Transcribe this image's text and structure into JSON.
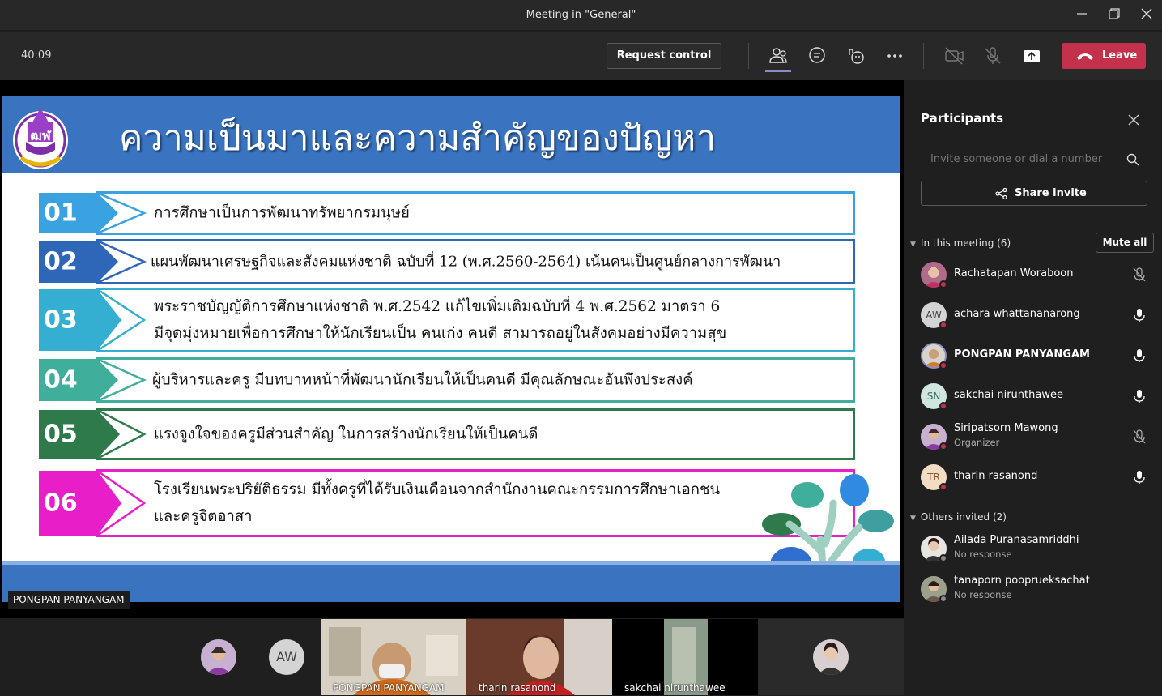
{
  "window": {
    "title": "Meeting in \"General\""
  },
  "toolbar": {
    "timer": "40:09",
    "request_control_label": "Request control",
    "leave_label": "Leave",
    "icons": [
      "participants-icon",
      "chat-icon",
      "reactions-icon",
      "more-icon",
      "camera-off-icon",
      "mic-off-icon",
      "share-tray-icon",
      "phone-icon"
    ]
  },
  "slide": {
    "title": "ความเป็นมาและความสำคัญของปัญหา",
    "presenter": "PONGPAN PANYANGAM",
    "rows": [
      {
        "num": "01",
        "color": "#3aa2e0",
        "lines": [
          "การศึกษาเป็นการพัฒนาทรัพยากรมนุษย์"
        ]
      },
      {
        "num": "02",
        "color": "#2e67b8",
        "lines": [
          "แผนพัฒนาเศรษฐกิจและสังคมแห่งชาติ ฉบับที่ 12 (พ.ศ.2560-2564) เน้นคนเป็นศูนย์กลางการพัฒนา"
        ]
      },
      {
        "num": "03",
        "color": "#34afd2",
        "lines": [
          "พระราชบัญญัติการศึกษาแห่งชาติ พ.ศ.2542 แก้ไขเพิ่มเติมฉบับที่ 4 พ.ศ.2562 มาตรา 6",
          "มีจุดมุ่งหมายเพื่อการศึกษาให้นักเรียนเป็น คนเก่ง คนดี สามารถอยู่ในสังคมอย่างมีความสุข"
        ]
      },
      {
        "num": "04",
        "color": "#3fae9b",
        "lines": [
          "ผู้บริหารและครู มีบทบาทหน้าที่พัฒนานักเรียนให้เป็นคนดี มีคุณลักษณะอันพึงประสงค์"
        ]
      },
      {
        "num": "05",
        "color": "#2e7a4a",
        "lines": [
          "แรงจูงใจของครูมีส่วนสำคัญ ในการสร้างนักเรียนให้เป็นคนดี"
        ]
      },
      {
        "num": "06",
        "color": "#e81fc8",
        "lines": [
          "โรงเรียนพระปริยัติธรรม มีทั้งครูที่ได้รับเงินเดือนจากสำนักงานคณะกรรมการศึกษาเอกชน",
          "และครูจิตอาสา"
        ]
      }
    ]
  },
  "panel": {
    "title": "Participants",
    "invite_placeholder": "Invite someone or dial a number",
    "share_invite_label": "Share invite",
    "in_meeting_label": "In this meeting (6)",
    "mute_all_label": "Mute all",
    "others_label": "Others invited (2)",
    "in_meeting": [
      {
        "name": "Rachatapan Woraboon",
        "sub": "",
        "initials": "",
        "avatar_color": "#b06a8a",
        "mic": "muted",
        "bold": false
      },
      {
        "name": "achara whattananarong",
        "sub": "",
        "initials": "AW",
        "avatar_color": "#d4d4d4",
        "mic": "on",
        "bold": false
      },
      {
        "name": "PONGPAN PANYANGAM",
        "sub": "",
        "initials": "",
        "avatar_color": "#c79a6a",
        "mic": "on",
        "bold": true
      },
      {
        "name": "sakchai nirunthawee",
        "sub": "",
        "initials": "SN",
        "avatar_color": "#cfe6e0",
        "mic": "on",
        "bold": false
      },
      {
        "name": "Siripatsorn Mawong",
        "sub": "Organizer",
        "initials": "",
        "avatar_color": "#8a5a8a",
        "mic": "muted",
        "bold": false
      },
      {
        "name": "tharin rasanond",
        "sub": "",
        "initials": "TR",
        "avatar_color": "#f3dcc4",
        "mic": "on",
        "bold": false
      }
    ],
    "others": [
      {
        "name": "Ailada Puranasamriddhi",
        "sub": "No response",
        "avatar_color": "#9a7a6a"
      },
      {
        "name": "tanaporn pooprueksachat",
        "sub": "No response",
        "avatar_color": "#7a8a6a"
      }
    ]
  },
  "gallery": {
    "avatar_initials": "AW",
    "tiles": [
      {
        "label": "PONGPAN PANYANGAM"
      },
      {
        "label": "tharin rasanond"
      },
      {
        "label": "sakchai nirunthawee"
      }
    ]
  }
}
